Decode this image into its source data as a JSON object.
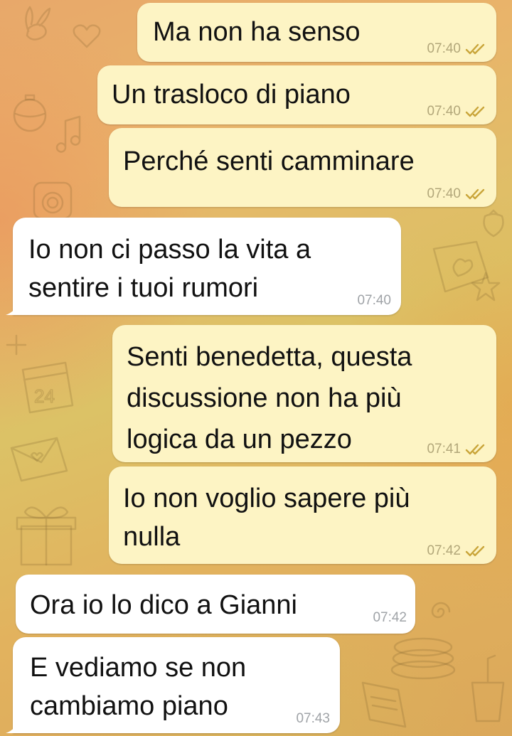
{
  "messages": [
    {
      "text": "Ma non ha senso",
      "time": "07:40",
      "dir": "out"
    },
    {
      "text": "Un trasloco di piano",
      "time": "07:40",
      "dir": "out"
    },
    {
      "text": "Perché senti camminare",
      "time": "07:40",
      "dir": "out"
    },
    {
      "text": "Io non ci passo la vita a\nsentire i tuoi rumori",
      "time": "07:40",
      "dir": "in"
    },
    {
      "text": "Senti benedetta, questa\ndiscussione non ha più\nlogica da un pezzo",
      "time": "07:41",
      "dir": "out"
    },
    {
      "text": "Io non voglio sapere più\nnulla",
      "time": "07:42",
      "dir": "out"
    },
    {
      "text": "Ora io lo dico a Gianni",
      "time": "07:42",
      "dir": "in"
    },
    {
      "text": "E vediamo se non\ncambiamo piano",
      "time": "07:43",
      "dir": "in"
    }
  ],
  "colors": {
    "outgoing_bubble": "#fdf4c4",
    "incoming_bubble": "#ffffff",
    "read_tick": "#c9a53a"
  },
  "icons": {
    "read_status": "double-check-icon"
  }
}
